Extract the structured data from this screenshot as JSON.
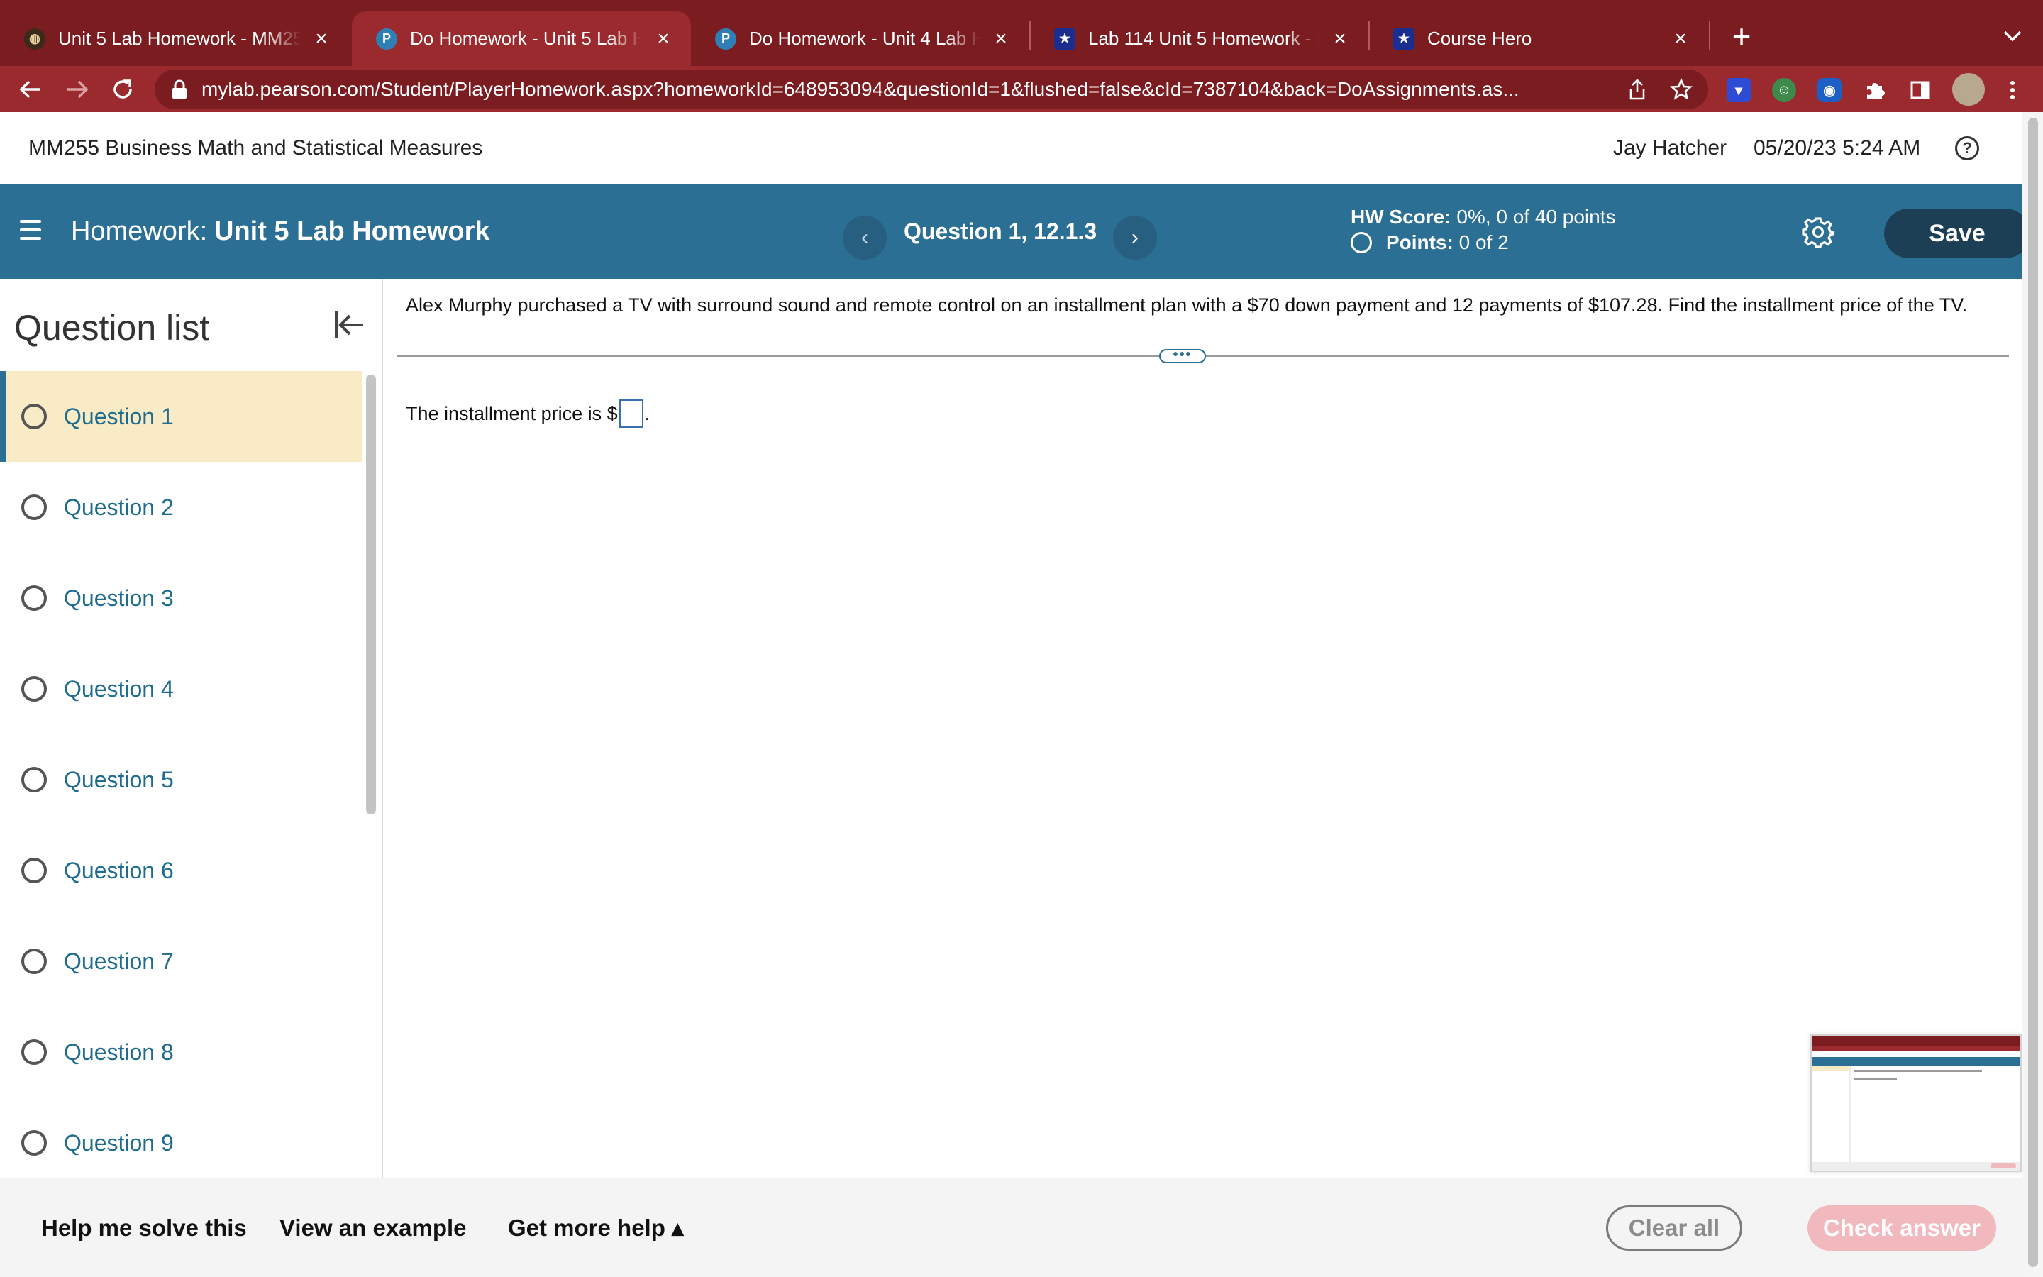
{
  "browser": {
    "tabs": [
      {
        "title": "Unit 5 Lab Homework - MM255",
        "favicon": "globe-icon"
      },
      {
        "title": "Do Homework - Unit 5 Lab Homework",
        "favicon": "P",
        "active": true
      },
      {
        "title": "Do Homework - Unit 4 Lab Homework",
        "favicon": "P"
      },
      {
        "title": "Lab 114 Unit 5 Homework - Exercises",
        "favicon": "★"
      },
      {
        "title": "Course Hero",
        "favicon": "★"
      }
    ],
    "url": "mylab.pearson.com/Student/PlayerHomework.aspx?homeworkId=648953094&questionId=1&flushed=false&cId=7387104&back=DoAssignments.as..."
  },
  "header": {
    "course_title": "MM255 Business Math and Statistical Measures",
    "user_name": "Jay Hatcher",
    "datetime": "05/20/23 5:24 AM",
    "help_symbol": "?"
  },
  "hw_bar": {
    "label": "Homework:",
    "name": "Unit 5 Lab Homework",
    "question_title": "Question 1, 12.1.3",
    "score_label": "HW Score:",
    "score_value": "0%, 0 of 40 points",
    "points_label": "Points:",
    "points_value": "0 of 2",
    "save_label": "Save"
  },
  "question_list": {
    "title": "Question list",
    "items": [
      {
        "label": "Question 1"
      },
      {
        "label": "Question 2"
      },
      {
        "label": "Question 3"
      },
      {
        "label": "Question 4"
      },
      {
        "label": "Question 5"
      },
      {
        "label": "Question 6"
      },
      {
        "label": "Question 7"
      },
      {
        "label": "Question 8"
      },
      {
        "label": "Question 9"
      }
    ]
  },
  "question": {
    "text": "Alex Murphy purchased a TV with surround sound and remote control on an installment plan with a $70 down payment and 12 payments of $107.28. Find the installment price of the TV.",
    "divider_handle": "•••",
    "answer_prefix": "The installment price is $",
    "answer_value": "",
    "answer_suffix": "."
  },
  "bottom_bar": {
    "help_solve": "Help me solve this",
    "view_example": "View an example",
    "get_help": "Get more help ▴",
    "clear_all": "Clear all",
    "check_answer": "Check answer"
  },
  "colors": {
    "browser_frame": "#7a1c20",
    "hw_bar": "#2c6f94",
    "active_question_bg": "#f8ebc5",
    "question_link": "#1f6c8f",
    "check_answer_disabled": "#f1b8be"
  }
}
